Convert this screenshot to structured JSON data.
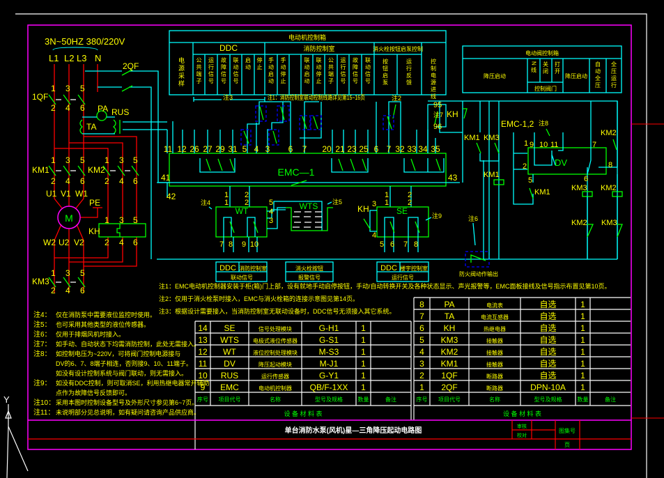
{
  "viewport": {
    "background": "#000000",
    "ucs_axis_label": "Y"
  },
  "colors": {
    "frame": "#ff00ff",
    "title_line": "#ff0000",
    "wiring": "#00ffff",
    "power": "#ff0000",
    "device": "#00ff00",
    "text": "#ffff00",
    "header_text": "#00ff00",
    "dashed_component": "#0000ff"
  },
  "power": {
    "supply": "3N~50HZ 380/220V",
    "phases": [
      "L1",
      "L2",
      "L3",
      "N"
    ],
    "qf2": "2QF",
    "qf1": "1QF",
    "top_terms": [
      "1",
      "3",
      "5"
    ],
    "bot_terms": [
      "2",
      "4",
      "6"
    ],
    "pa": "PA",
    "rus": "RUS",
    "ta": "TA",
    "km1": "KM1",
    "km2": "KM2",
    "km3": "KM3",
    "kh": "KH",
    "pe": "PE",
    "motor": "M",
    "motor_in": [
      "U1",
      "V1",
      "W1"
    ],
    "motor_out": [
      "W2",
      "U2",
      "V2"
    ]
  },
  "emc": {
    "label": "EMC—1",
    "terminals": [
      "11",
      "12",
      "26",
      "27",
      "29",
      "31",
      "5",
      "4",
      "3",
      "6",
      "7",
      "20",
      "21",
      "23",
      "25",
      "6",
      "7",
      "32",
      "33",
      "34",
      "35"
    ],
    "left_term": "41",
    "right_term": "43",
    "bottom_term": "42"
  },
  "markers": {
    "n1": "注1：消防控制室联动控制线路详见第15~16页",
    "n2": "注2",
    "n3": "注3",
    "n4": "注4",
    "n5": "注5",
    "n6": "注6",
    "n7": "注7",
    "n8": "注8",
    "n9": "注9"
  },
  "wt": {
    "label": "WT",
    "in": [
      "1",
      "2"
    ],
    "side": [
      "5",
      "4",
      "3"
    ],
    "out": [
      "7",
      "8",
      "9",
      "10"
    ]
  },
  "wts": {
    "label": "WTS"
  },
  "se": {
    "label": "SE",
    "kh": "KH",
    "in": [
      "1",
      "2"
    ],
    "side": [
      "3",
      "4"
    ],
    "out": [
      "5",
      "6",
      "7",
      "8"
    ]
  },
  "ddc_boxes": [
    {
      "a": "DDC",
      "b": "消防控制室",
      "c": "联动信号"
    },
    {
      "b": "消火栓按钮",
      "c": "报警信号"
    },
    {
      "a": "DDC",
      "b": "楼宇控制室",
      "c": "运行信号"
    }
  ],
  "fire_valve": "防火阀动作输出",
  "right_circuit": {
    "t95": "95",
    "kh": "KH",
    "t96": "96",
    "km1": "KM1",
    "km3": "KM3",
    "km1_coil": "KM1",
    "emc12": "EMC-1,2",
    "dv": "DV",
    "dv_terms": [
      "1",
      "9",
      "10",
      "11",
      "2",
      "7",
      "8",
      "5",
      "6"
    ],
    "km1_contact": "KM1",
    "km3_coil": "KM3",
    "km2_contact": "KM2",
    "km2_coil": "KM2",
    "km2_nc": "KM2",
    "km3_nc": "KM3"
  },
  "top_table": {
    "title": "电动机控制箱",
    "col0": "电源采样",
    "ddc": {
      "header": "DDC",
      "subs": [
        "公共端子",
        "运行信号",
        "故障信号",
        "联动信号",
        "启动",
        "停止"
      ]
    },
    "fire": {
      "header": "消防控制室",
      "subs": [
        "手动启动",
        "手动停止",
        "",
        "联动启动",
        "联动停止",
        "公共端子",
        "运行信号",
        "故障信号",
        "联动信号"
      ]
    },
    "hydrant": {
      "header": "消火栓按钮启泵控制",
      "subs": [
        "按钮启泵",
        "运行反馈"
      ]
    },
    "last": "控制电源进线"
  },
  "right_table": {
    "title": "电动阀控制箱",
    "c1": "降压启动",
    "subs": [
      "N线",
      "关闭",
      "打开"
    ],
    "sub_footer": "控制阀门",
    "c2": "降压启动",
    "c3": "自动全压",
    "c4": "全压运行"
  },
  "notes_top": [
    "注1：EMC电动机控制器安装于柜(箱)门上部，设有就地手动启停按钮，手动/自动转换开关及各种状态显示、声光报警等，EMC面板接线及信号指示布置见第10页。",
    "注2：仅用于消火栓泵时接入，EMC与消火栓箱的连接示意图见第14页。",
    "注3：根据设计需要接入，当消防控制室无联动设备时，DDC信号无须接入其它系统。"
  ],
  "notes_left": [
    {
      "k": "注4：",
      "t": "仅在消防泵中需要液位监控时使用。"
    },
    {
      "k": "注5：",
      "t": "也可采用其他类型的液位传感器。"
    },
    {
      "k": "注6：",
      "t": "仅用于排烟风机时接入。"
    },
    {
      "k": "注7：",
      "t": "如手动、自动状态下均需消防控制，此处无需接入。"
    },
    {
      "k": "注8：",
      "t": "如控制电压为~220V，可将阀门控制电源接与"
    },
    {
      "k": "",
      "t": "DV的6、7、8端子相连，否则接9、10、11端子。"
    },
    {
      "k": "",
      "t": "如没有设计控制系统与阀门联动，则无需接入。"
    },
    {
      "k": "注9：",
      "t": "如没有DDC控制，则可取消SE，利用热继电器常开辅助"
    },
    {
      "k": "",
      "t": "点作为故障信号反馈即可。"
    },
    {
      "k": "注10：",
      "t": "采用本图时控制设备型号及外形尺寸参见第6~7页。"
    },
    {
      "k": "注11：",
      "t": "未说明部分见总说明，如有疑问请咨询产品供应商。"
    }
  ],
  "material_table_left": {
    "rows": [
      [
        "14",
        "SE",
        "信号处理模块",
        "G-H1",
        "1",
        ""
      ],
      [
        "13",
        "WTS",
        "电极式液位传感器",
        "G-S1",
        "1",
        ""
      ],
      [
        "12",
        "WT",
        "液位控制处理模块",
        "M-S3",
        "1",
        ""
      ],
      [
        "11",
        "DV",
        "降压起动模块",
        "M-J1",
        "1",
        ""
      ],
      [
        "10",
        "RUS",
        "运行传感器",
        "G-Y1",
        "1",
        ""
      ],
      [
        "9",
        "EMC",
        "电动机控制器",
        "QB/F-1XX",
        "1",
        ""
      ]
    ],
    "headers": [
      "序号",
      "项目代号",
      "名称",
      "型号及规格",
      "数量",
      "备注"
    ],
    "title": "设 备 材 料 表"
  },
  "material_table_right": {
    "rows": [
      [
        "8",
        "PA",
        "电流表",
        "自选",
        "1",
        ""
      ],
      [
        "7",
        "TA",
        "电流互感器",
        "自选",
        "1",
        ""
      ],
      [
        "6",
        "KH",
        "热继电器",
        "自选",
        "1",
        ""
      ],
      [
        "5",
        "KM3",
        "接触器",
        "自选",
        "1",
        ""
      ],
      [
        "4",
        "KM2",
        "接触器",
        "自选",
        "1",
        ""
      ],
      [
        "3",
        "KM1",
        "接触器",
        "自选",
        "1",
        ""
      ],
      [
        "2",
        "1QF",
        "断路器",
        "自选",
        "1",
        ""
      ],
      [
        "1",
        "2QF",
        "断路器",
        "DPN-10A",
        "1",
        ""
      ]
    ],
    "headers": [
      "序号",
      "项目代号",
      "名称",
      "型号及规格",
      "数量",
      "备注"
    ],
    "title": "设 备 材 料 表"
  },
  "title_block": {
    "title": "单台消防水泵(风机)星—三角降压起动电路图",
    "review": "审核",
    "check": "校对",
    "atlas_no": "图集号",
    "page": "页"
  }
}
